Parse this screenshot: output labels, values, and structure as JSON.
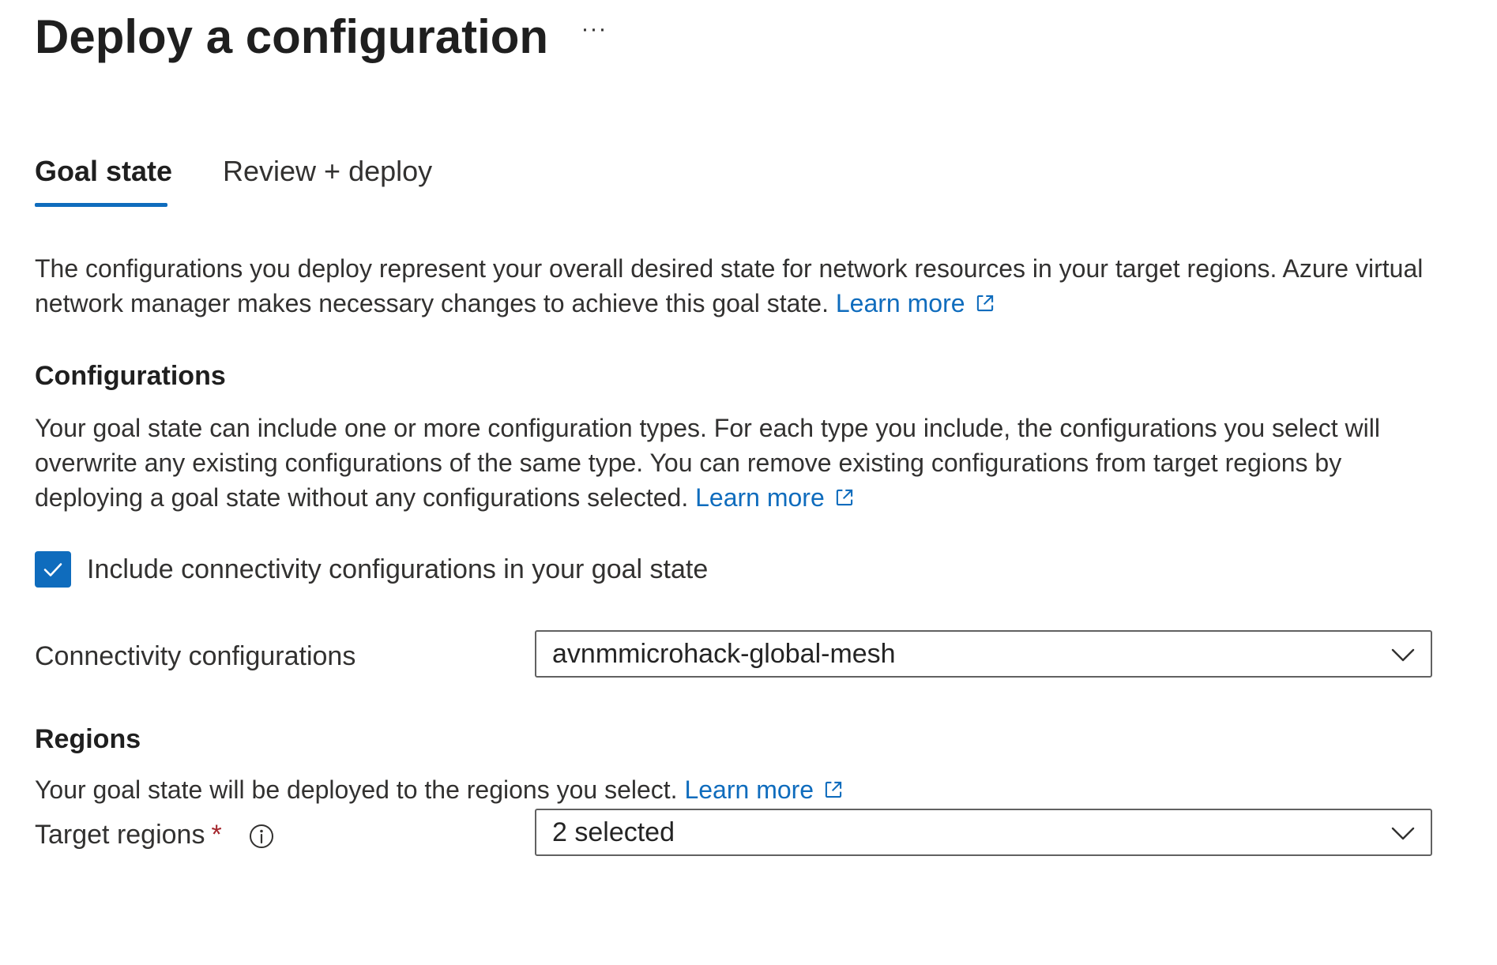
{
  "header": {
    "title": "Deploy a configuration",
    "more_label": "···"
  },
  "tabs": [
    {
      "label": "Goal state",
      "active": true
    },
    {
      "label": "Review + deploy",
      "active": false
    }
  ],
  "intro": {
    "text": "The configurations you deploy represent your overall desired state for network resources in your target regions. Azure virtual network manager makes necessary changes to achieve this goal state.",
    "link": "Learn more"
  },
  "configurations": {
    "heading": "Configurations",
    "description": "Your goal state can include one or more configuration types. For each type you include, the configurations you select will overwrite any existing configurations of the same type. You can remove existing configurations from target regions by deploying a goal state without any configurations selected.",
    "link": "Learn more",
    "include_checkbox": {
      "label": "Include connectivity configurations in your goal state",
      "checked": true
    },
    "connectivity_field": {
      "label": "Connectivity configurations",
      "value": "avnmmicrohack-global-mesh"
    }
  },
  "regions": {
    "heading": "Regions",
    "description": "Your goal state will be deployed to the regions you select.",
    "link": "Learn more",
    "target_field": {
      "label": "Target regions",
      "required_marker": "*",
      "value": "2 selected"
    }
  },
  "icons": {
    "external_link": "external-link-icon",
    "checkmark": "checkmark-icon",
    "chevron": "chevron-down-icon",
    "info": "info-icon"
  },
  "colors": {
    "accent": "#0f6cbd",
    "text": "#323130",
    "required": "#a4262c",
    "border": "#616161"
  }
}
